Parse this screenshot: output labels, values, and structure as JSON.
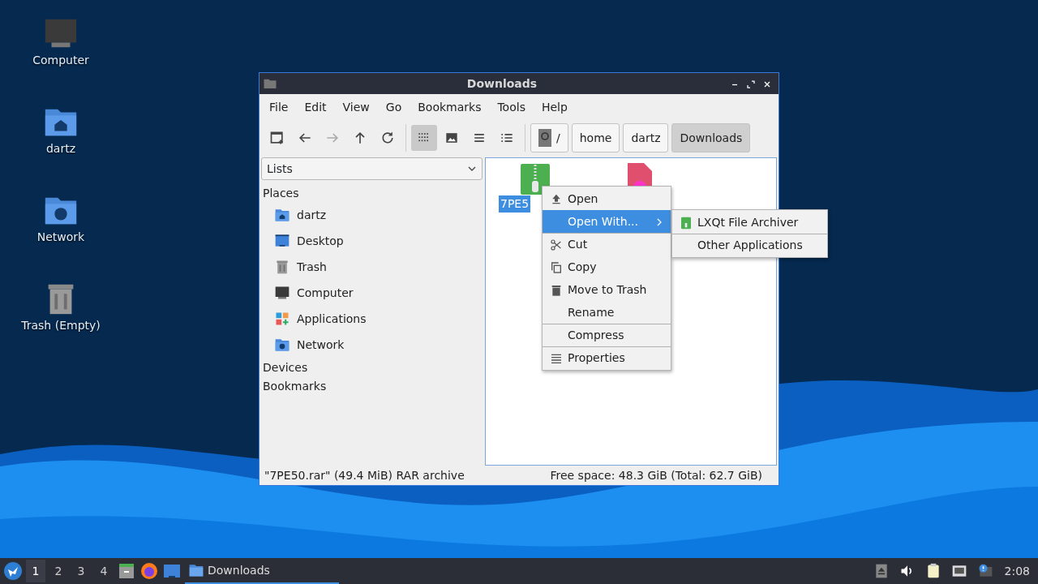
{
  "desktop_icons": [
    {
      "label": "Computer",
      "kind": "computer"
    },
    {
      "label": "dartz",
      "kind": "home"
    },
    {
      "label": "Network",
      "kind": "network"
    },
    {
      "label": "Trash (Empty)",
      "kind": "trash"
    }
  ],
  "window": {
    "title": "Downloads",
    "menu": [
      "File",
      "Edit",
      "View",
      "Go",
      "Bookmarks",
      "Tools",
      "Help"
    ],
    "nav_buttons": [
      {
        "kind": "new-tab",
        "disabled": false
      },
      {
        "kind": "back",
        "disabled": false
      },
      {
        "kind": "forward",
        "disabled": true
      },
      {
        "kind": "up",
        "disabled": false
      },
      {
        "kind": "reload",
        "disabled": false
      }
    ],
    "view_buttons": [
      {
        "kind": "icons",
        "selected": true
      },
      {
        "kind": "thumbnails",
        "selected": false
      },
      {
        "kind": "compact",
        "selected": false
      },
      {
        "kind": "details",
        "selected": false
      }
    ],
    "path": [
      {
        "label": "/",
        "kind": "root",
        "selected": false
      },
      {
        "label": "home",
        "kind": "folder",
        "selected": false
      },
      {
        "label": "dartz",
        "kind": "folder",
        "selected": false
      },
      {
        "label": "Downloads",
        "kind": "folder",
        "selected": true
      }
    ],
    "sidebar": {
      "dropdown": "Lists",
      "sections": [
        {
          "title": "Places",
          "items": [
            {
              "label": "dartz",
              "kind": "home"
            },
            {
              "label": "Desktop",
              "kind": "desktop"
            },
            {
              "label": "Trash",
              "kind": "trash"
            },
            {
              "label": "Computer",
              "kind": "computer"
            },
            {
              "label": "Applications",
              "kind": "apps"
            },
            {
              "label": "Network",
              "kind": "network"
            }
          ]
        },
        {
          "title": "Devices"
        },
        {
          "title": "Bookmarks"
        }
      ]
    },
    "files": [
      {
        "name": "7PE5",
        "kind": "archive",
        "selected": true
      },
      {
        "kind": "document"
      }
    ],
    "status_bar": {
      "left": "\"7PE50.rar\" (49.4 MiB) RAR archive",
      "right": "Free space: 48.3 GiB (Total: 62.7 GiB)"
    }
  },
  "context_menu": [
    {
      "label": "Open",
      "kind": "open",
      "selected": false,
      "submenu": false,
      "separator_before": false
    },
    {
      "label": "Open With...",
      "kind": "none",
      "selected": true,
      "submenu": true,
      "separator_before": false
    },
    {
      "label": "Cut",
      "kind": "cut",
      "selected": false,
      "submenu": false,
      "separator_before": true
    },
    {
      "label": "Copy",
      "kind": "copy",
      "selected": false,
      "submenu": false,
      "separator_before": false
    },
    {
      "label": "Move to Trash",
      "kind": "trash",
      "selected": false,
      "submenu": false,
      "separator_before": false
    },
    {
      "label": "Rename",
      "kind": "none",
      "selected": false,
      "submenu": false,
      "separator_before": false
    },
    {
      "label": "Compress",
      "kind": "none",
      "selected": false,
      "submenu": false,
      "separator_before": true
    },
    {
      "label": "Properties",
      "kind": "properties",
      "selected": false,
      "submenu": false,
      "separator_before": true
    }
  ],
  "submenu": [
    {
      "label": "LXQt File Archiver",
      "kind": "archiver",
      "separator_before": false
    },
    {
      "label": "Other Applications",
      "kind": "none",
      "separator_before": true
    }
  ],
  "taskbar": {
    "workspaces": [
      {
        "label": "1",
        "selected": true
      },
      {
        "label": "2",
        "selected": false
      },
      {
        "label": "3",
        "selected": false
      },
      {
        "label": "4",
        "selected": false
      }
    ],
    "launchers": [
      {
        "kind": "file-cabinet"
      },
      {
        "kind": "browser"
      },
      {
        "kind": "desktop"
      }
    ],
    "tasks": [
      {
        "label": "Downloads",
        "selected": true
      }
    ],
    "tray": [
      {
        "kind": "eject"
      },
      {
        "kind": "volume"
      },
      {
        "kind": "clipboard"
      },
      {
        "kind": "network"
      },
      {
        "kind": "notification"
      }
    ],
    "clock": "2:08"
  }
}
